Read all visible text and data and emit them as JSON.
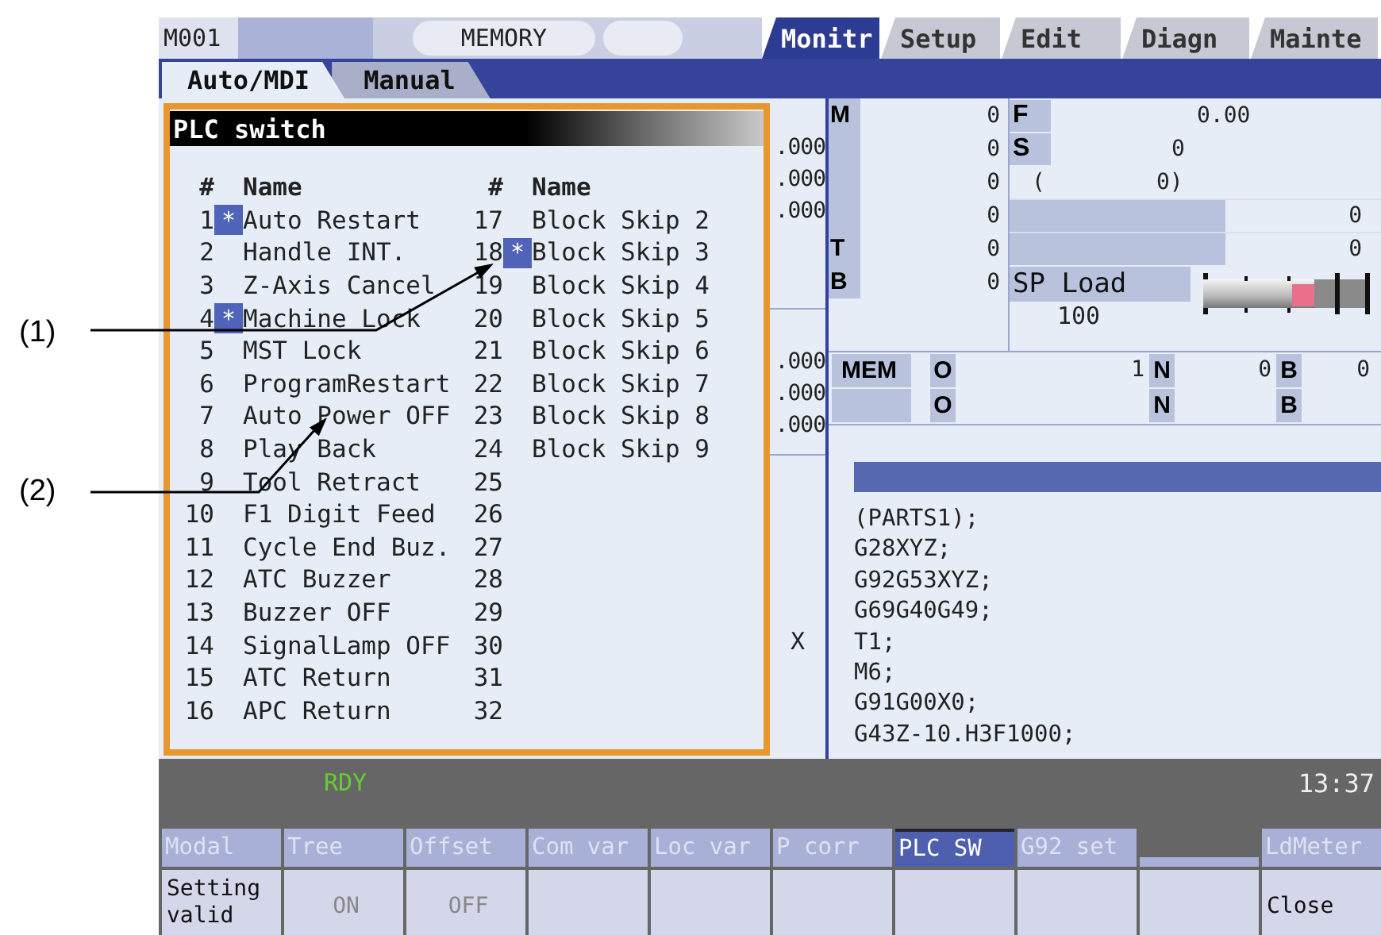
{
  "callouts": [
    {
      "label": "(1)"
    },
    {
      "label": "(2)"
    }
  ],
  "top_bar": {
    "machine": "M001",
    "mode": "MEMORY"
  },
  "screen_tabs": [
    {
      "label": "Monitr",
      "selected": true
    },
    {
      "label": "Setup",
      "selected": false
    },
    {
      "label": "Edit",
      "selected": false
    },
    {
      "label": "Diagn",
      "selected": false
    },
    {
      "label": "Mainte",
      "selected": false
    }
  ],
  "sub_tabs": [
    {
      "label": "Auto/MDI",
      "selected": true
    },
    {
      "label": "Manual",
      "selected": false
    }
  ],
  "plc_switch": {
    "title": "PLC switch",
    "headers": [
      "#",
      "Name",
      "#",
      "Name"
    ],
    "on_mark": "*",
    "items": [
      {
        "no": "1",
        "name": "Auto Restart",
        "on": true
      },
      {
        "no": "2",
        "name": "Handle INT.",
        "on": false
      },
      {
        "no": "3",
        "name": "Z-Axis Cancel",
        "on": false
      },
      {
        "no": "4",
        "name": "Machine Lock",
        "on": true
      },
      {
        "no": "5",
        "name": "MST Lock",
        "on": false
      },
      {
        "no": "6",
        "name": "ProgramRestart",
        "on": false
      },
      {
        "no": "7",
        "name": "Auto Power OFF",
        "on": false
      },
      {
        "no": "8",
        "name": "Play Back",
        "on": false
      },
      {
        "no": "9",
        "name": "Tool Retract",
        "on": false
      },
      {
        "no": "10",
        "name": "F1 Digit Feed",
        "on": false
      },
      {
        "no": "11",
        "name": "Cycle End Buz.",
        "on": false
      },
      {
        "no": "12",
        "name": "ATC Buzzer",
        "on": false
      },
      {
        "no": "13",
        "name": "Buzzer OFF",
        "on": false
      },
      {
        "no": "14",
        "name": "SignalLamp OFF",
        "on": false
      },
      {
        "no": "15",
        "name": "ATC Return",
        "on": false
      },
      {
        "no": "16",
        "name": "APC Return",
        "on": false
      },
      {
        "no": "17",
        "name": "Block Skip 2",
        "on": false
      },
      {
        "no": "18",
        "name": "Block Skip 3",
        "on": true
      },
      {
        "no": "19",
        "name": "Block Skip 4",
        "on": false
      },
      {
        "no": "20",
        "name": "Block Skip 5",
        "on": false
      },
      {
        "no": "21",
        "name": "Block Skip 6",
        "on": false
      },
      {
        "no": "22",
        "name": "Block Skip 7",
        "on": false
      },
      {
        "no": "23",
        "name": "Block Skip 8",
        "on": false
      },
      {
        "no": "24",
        "name": "Block Skip 9",
        "on": false
      },
      {
        "no": "25",
        "on": false
      },
      {
        "no": "26",
        "on": false
      },
      {
        "no": "27",
        "on": false
      },
      {
        "no": "28",
        "on": false
      },
      {
        "no": "29",
        "on": false
      },
      {
        "no": "30",
        "on": false
      },
      {
        "no": "31",
        "on": false
      },
      {
        "no": "32",
        "on": false
      }
    ]
  },
  "position_strip": {
    "upper": [
      ".000",
      ".000",
      ".000"
    ],
    "lower": [
      ".000",
      ".000",
      ".000"
    ],
    "axis": "X"
  },
  "codes": [
    {
      "label": "M",
      "value": "0"
    },
    {
      "value": "0"
    },
    {
      "value": "0"
    },
    {
      "value": "0"
    },
    {
      "label": "T",
      "value": "0"
    },
    {
      "label": "B",
      "value": "0"
    }
  ],
  "feed": [
    {
      "kind": "labeled",
      "label": "F",
      "value": "0.00"
    },
    {
      "kind": "labeled",
      "label": "S",
      "value": "0"
    },
    {
      "kind": "paren",
      "prefix": "(",
      "value": "0)"
    }
  ],
  "bars": [
    {
      "value": "0"
    },
    {
      "value": "0"
    }
  ],
  "spindle": {
    "label": "SP Load",
    "value": "100",
    "level": 0.66
  },
  "program_rows": [
    {
      "mode": "MEM",
      "fields": [
        {
          "label": "O",
          "value": "1"
        },
        {
          "label": "N",
          "value": "0"
        },
        {
          "label": "B",
          "value": "0"
        }
      ]
    },
    {
      "fields": [
        {
          "label": "O"
        },
        {
          "label": "N"
        },
        {
          "label": "B"
        }
      ]
    }
  ],
  "program": {
    "lines": [
      "(PARTS1);",
      "G28XYZ;",
      "G92G53XYZ;",
      "G69G40G49;",
      "T1;",
      "M6;",
      "G91G00X0;",
      "G43Z-10.H3F1000;"
    ]
  },
  "status": {
    "state": "RDY",
    "time": "13:37"
  },
  "menu_keys": [
    {
      "label": "Modal",
      "selected": false,
      "disabled": true,
      "value": "Setting valid",
      "value_disabled": false
    },
    {
      "label": "Tree",
      "selected": false,
      "disabled": true,
      "value": "ON",
      "value_disabled": true
    },
    {
      "label": "Offset",
      "selected": false,
      "disabled": true,
      "value": "OFF",
      "value_disabled": true
    },
    {
      "label": "Com var",
      "selected": false,
      "disabled": true
    },
    {
      "label": "Loc var",
      "selected": false,
      "disabled": true
    },
    {
      "label": "P corr",
      "selected": false,
      "disabled": true
    },
    {
      "label": "PLC SW",
      "selected": true,
      "disabled": false
    },
    {
      "label": "G92 set",
      "selected": false,
      "disabled": true
    },
    {
      "selected": false
    },
    {
      "label": "LdMeter",
      "selected": false,
      "disabled": true,
      "value": "Close",
      "value_disabled": false
    }
  ]
}
